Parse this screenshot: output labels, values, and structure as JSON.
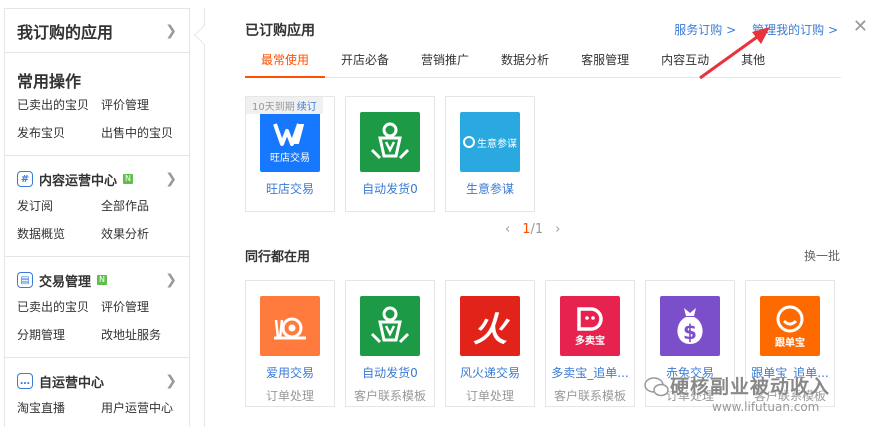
{
  "sidebar": {
    "header_title": "我订购的应用",
    "common": {
      "title": "常用操作",
      "items": [
        "已卖出的宝贝",
        "评价管理",
        "发布宝贝",
        "出售中的宝贝"
      ]
    },
    "groups": [
      {
        "title": "内容运营中心",
        "icon": "hash-icon",
        "badge": "N",
        "items": [
          "发订阅",
          "全部作品",
          "数据概览",
          "效果分析"
        ]
      },
      {
        "title": "交易管理",
        "icon": "calendar-icon",
        "badge": "N",
        "items": [
          "已卖出的宝贝",
          "评价管理",
          "分期管理",
          "改地址服务"
        ]
      },
      {
        "title": "自运营中心",
        "icon": "chat-icon",
        "badge": "",
        "items": [
          "淘宝直播",
          "用户运营中心"
        ]
      }
    ]
  },
  "panel": {
    "title": "已订购应用",
    "links": [
      "服务订购 >",
      "管理我的订购 >"
    ],
    "tabs": [
      "最常使用",
      "开店必备",
      "营销推广",
      "数据分析",
      "客服管理",
      "内容互动",
      "其他"
    ],
    "active_tab": 0,
    "purchased": [
      {
        "name": "旺店交易",
        "logo_text": "旺店交易",
        "logo_icon": "w-logo-icon",
        "color": "#1677ff",
        "expire": "10天到期",
        "renew": "续订"
      },
      {
        "name": "自动发货0",
        "logo_text": "",
        "logo_icon": "robot-logo-icon",
        "color": "#1d9a46"
      },
      {
        "name": "生意参谋",
        "logo_text": "生意参谋",
        "logo_icon": "shengyi-logo-icon",
        "color": "#2aa8e0"
      }
    ],
    "pager": {
      "prev": "‹",
      "current": "1",
      "total": "/1",
      "next": "›"
    },
    "peers_title": "同行都在用",
    "refresh": "换一批",
    "peers": [
      {
        "name": "爱用交易",
        "category": "订单处理",
        "logo_icon": "snail-logo-icon",
        "color": "#ff7a3d"
      },
      {
        "name": "自动发货0",
        "category": "客户联系模板",
        "logo_icon": "robot-logo-icon",
        "color": "#1d9a46"
      },
      {
        "name": "风火递交易",
        "category": "订单处理",
        "logo_text": "火",
        "logo_icon": "fire-logo-icon",
        "color": "#e2231a"
      },
      {
        "name": "多卖宝_追单...",
        "category": "客户联系模板",
        "logo_text": "多卖宝",
        "logo_icon": "d-logo-icon",
        "color": "#e8224f"
      },
      {
        "name": "赤兔交易",
        "category": "订单处理",
        "logo_icon": "moneybag-logo-icon",
        "color": "#7b4fc9"
      },
      {
        "name": "跟单宝_追单...",
        "category": "客户联系模板",
        "logo_text": "跟单宝",
        "logo_icon": "smile-logo-icon",
        "color": "#ff6a00"
      }
    ]
  },
  "watermark": {
    "line1": "硬核副业被动收入",
    "line2": "www.lifutuan.com"
  },
  "colors": {
    "accent": "#ff5000",
    "link": "#3a7bd5",
    "annotation": "#e8323c"
  }
}
